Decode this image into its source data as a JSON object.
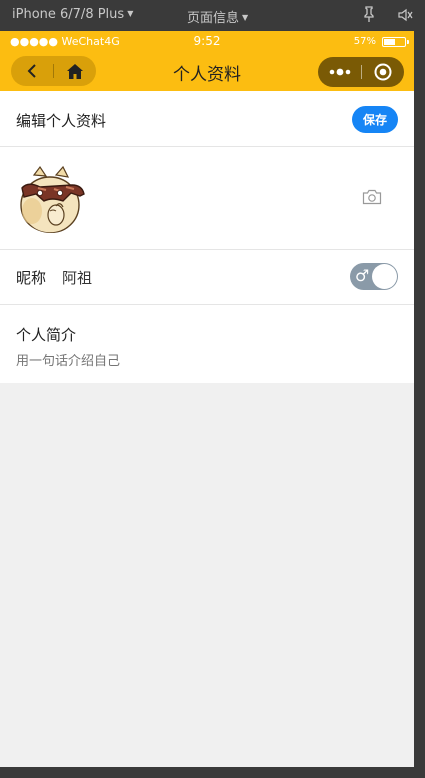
{
  "devtools": {
    "device_label": "iPhone 6/7/8 Plus",
    "page_info_label": "页面信息",
    "icons": [
      "pin-icon",
      "mute-icon"
    ]
  },
  "status_bar": {
    "carrier": "●●●●● WeChat4G",
    "time": "9:52",
    "battery_percent": "57%",
    "battery_level": 0.57
  },
  "nav": {
    "title": "个人资料",
    "color": "#fcbd11",
    "icons": [
      "back-icon",
      "home-icon",
      "more-icon",
      "close-mini-program-icon"
    ]
  },
  "profile": {
    "header_label": "编辑个人资料",
    "save_label": "保存",
    "save_color": "#1685f5",
    "avatar_icon": "avatar-cartoon-image",
    "camera_icon": "camera-icon",
    "nickname_label": "昵称",
    "nickname_value": "阿祖",
    "gender_symbol": "♂",
    "gender_toggle_on": true,
    "bio_label": "个人简介",
    "bio_placeholder": "用一句话介绍自己"
  }
}
